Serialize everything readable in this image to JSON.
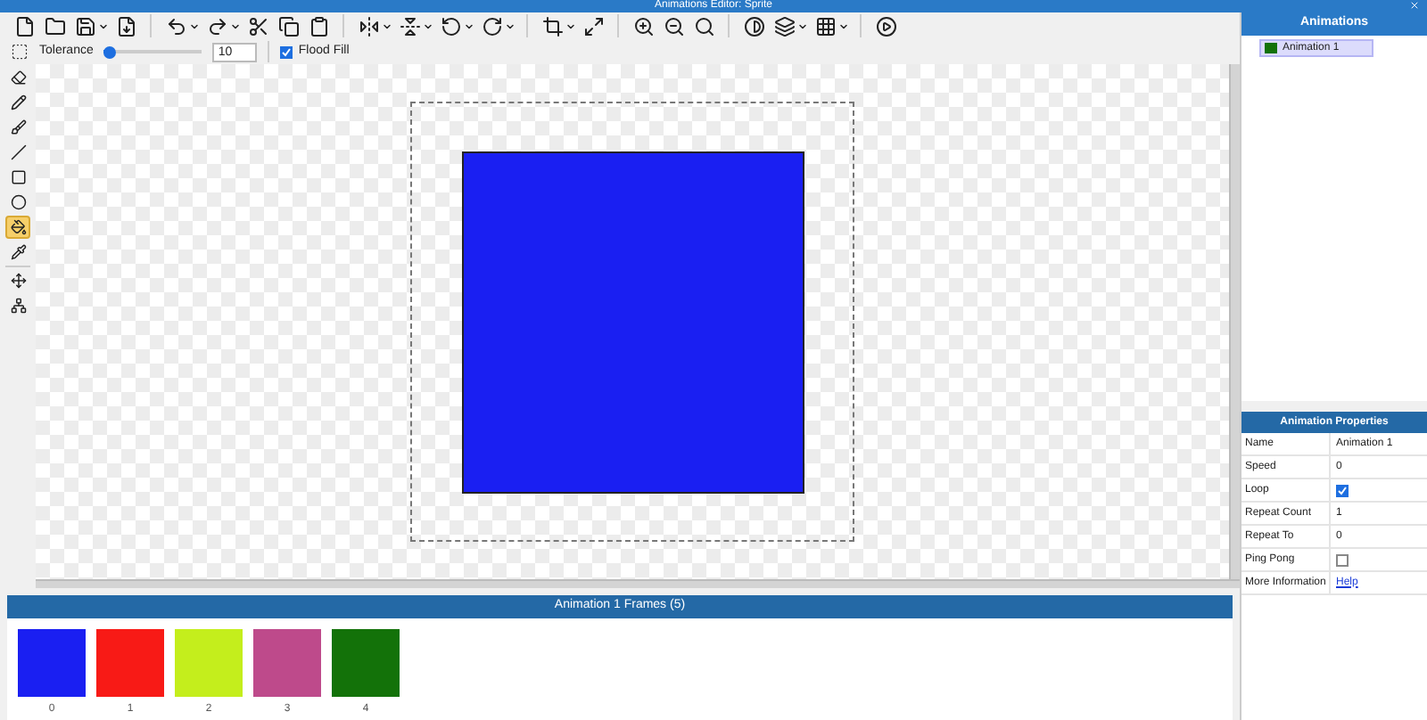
{
  "window": {
    "title": "Animations Editor: Sprite"
  },
  "options": {
    "tolerance_label": "Tolerance",
    "tolerance": {
      "level": 0.05
    },
    "tolerance_value": "10",
    "flood_fill": {
      "label": "Flood Fill",
      "checked": true
    }
  },
  "tools": [
    {
      "kind": "eraser",
      "selected": false
    },
    {
      "kind": "pencil",
      "selected": false
    },
    {
      "kind": "brush",
      "selected": false
    },
    {
      "kind": "line",
      "selected": false
    },
    {
      "kind": "rect",
      "selected": false
    },
    {
      "kind": "circle",
      "selected": false
    },
    {
      "kind": "fill",
      "selected": true
    },
    {
      "kind": "picker",
      "selected": false
    },
    {
      "kind": "point",
      "selected": false
    },
    {
      "kind": "nodes",
      "selected": false
    }
  ],
  "frames_panel": {
    "title": "Animation 1 Frames (5)",
    "frames": [
      {
        "label": "0",
        "color": "#1a1ff2"
      },
      {
        "label": "1",
        "color": "#f81a16"
      },
      {
        "label": "2",
        "color": "#c4ee1c"
      },
      {
        "label": "3",
        "color": "#be4a8b"
      },
      {
        "label": "4",
        "color": "#137209"
      }
    ]
  },
  "animations_panel": {
    "title": "Animations",
    "items": [
      {
        "label": "Animation 1",
        "color": "#137209",
        "selected": true
      }
    ]
  },
  "properties_panel": {
    "title": "Animation Properties",
    "rows": [
      {
        "kind": "text",
        "name": "Name",
        "value": "Animation 1"
      },
      {
        "kind": "text",
        "name": "Speed",
        "value": "0"
      },
      {
        "kind": "checkbox",
        "name": "Loop",
        "checked": true
      },
      {
        "kind": "text",
        "name": "Repeat Count",
        "value": "1"
      },
      {
        "kind": "text",
        "name": "Repeat To",
        "value": "0"
      },
      {
        "kind": "checkbox",
        "name": "Ping Pong",
        "checked": false
      },
      {
        "kind": "link",
        "name": "More Information",
        "value": "Help"
      }
    ]
  }
}
